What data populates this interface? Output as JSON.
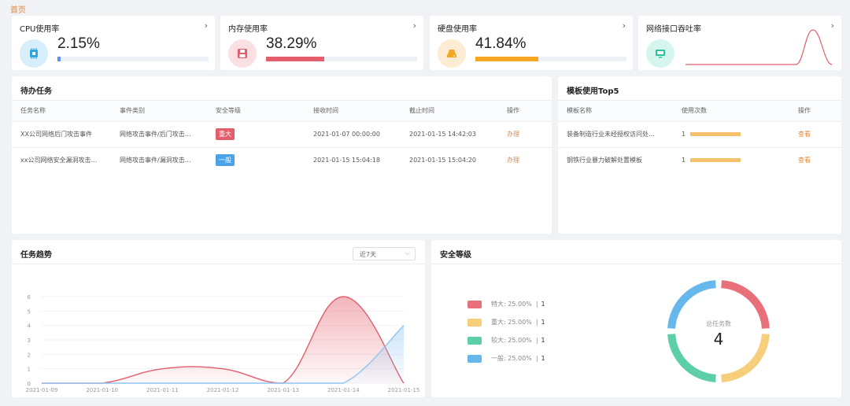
{
  "breadcrumb": "首页",
  "stats": [
    {
      "title": "CPU使用率",
      "value": "2.15%",
      "percent": 2.15,
      "color": "#5b8ff9",
      "iconBg": "#d9eefb",
      "iconColor": "#2ea7e0",
      "icon": "chip-icon"
    },
    {
      "title": "内存使用率",
      "value": "38.29%",
      "percent": 38.29,
      "color": "#e35d6a",
      "iconBg": "#fbe0e3",
      "iconColor": "#e35d6a",
      "icon": "floppy-icon"
    },
    {
      "title": "硬盘使用率",
      "value": "41.84%",
      "percent": 41.84,
      "color": "#f5a623",
      "iconBg": "#fdecd3",
      "iconColor": "#f5a623",
      "icon": "hdd-icon"
    },
    {
      "title": "网络接口吞吐率",
      "iconBg": "#d6f5ee",
      "iconColor": "#2ebf9f",
      "icon": "monitor-icon"
    }
  ],
  "todo": {
    "title": "待办任务",
    "headers": [
      "任务名称",
      "事件类别",
      "安全等级",
      "接收时间",
      "截止时间",
      "操作"
    ],
    "rows": [
      {
        "name": "XX公司网络后门攻击事件",
        "category": "网络攻击事件/后门攻击…",
        "level": "重大",
        "levelColor": "#e35d6a",
        "received": "2021-01-07 00:00:00",
        "deadline": "2021-01-15 14:42:03",
        "action": "办理"
      },
      {
        "name": "xx公司网络安全漏洞攻击…",
        "category": "网络攻击事件/漏洞攻击…",
        "level": "一般",
        "levelColor": "#4aa3e8",
        "received": "2021-01-15 15:04:18",
        "deadline": "2021-01-15 15:04:20",
        "action": "办理"
      }
    ]
  },
  "templates": {
    "title": "模板使用Top5",
    "headers": [
      "模板名称",
      "使用次数",
      "操作"
    ],
    "rows": [
      {
        "name": "装备制造行业未经授权访问处…",
        "count": "1",
        "action": "查看"
      },
      {
        "name": "钢铁行业暴力破解处置模板",
        "count": "1",
        "action": "查看"
      }
    ]
  },
  "trend": {
    "title": "任务趋势",
    "range": "近7天"
  },
  "security": {
    "title": "安全等级",
    "center_label": "总任务数",
    "center_value": "4",
    "legend": [
      {
        "name": "特大:",
        "pct": "25.00%",
        "count": "1",
        "color": "#e8707b"
      },
      {
        "name": "重大:",
        "pct": "25.00%",
        "count": "1",
        "color": "#f7cf7b"
      },
      {
        "name": "较大:",
        "pct": "25.00%",
        "count": "1",
        "color": "#5ccfa9"
      },
      {
        "name": "一般:",
        "pct": "25.00%",
        "count": "1",
        "color": "#66b8ec"
      }
    ]
  },
  "chart_data": [
    {
      "type": "line",
      "x": [
        "2021-01-09",
        "2021-01-10",
        "2021-01-11",
        "2021-01-12",
        "2021-01-13",
        "2021-01-14",
        "2021-01-15"
      ],
      "ylim": [
        0,
        6
      ],
      "yticks": [
        "0",
        "1",
        "2",
        "3",
        "4",
        "5",
        "6"
      ],
      "series": [
        {
          "values": [
            0,
            0,
            1,
            1,
            0,
            6,
            0
          ],
          "color": "#e35d6a"
        },
        {
          "values": [
            0,
            0,
            0,
            0,
            0,
            0,
            4
          ],
          "color": "#8ec5f2"
        }
      ]
    },
    {
      "type": "pie",
      "labels": [
        "特大",
        "重大",
        "较大",
        "一般"
      ],
      "values": [
        1,
        1,
        1,
        1
      ],
      "colors": [
        "#e8707b",
        "#f7cf7b",
        "#5ccfa9",
        "#66b8ec"
      ]
    }
  ]
}
